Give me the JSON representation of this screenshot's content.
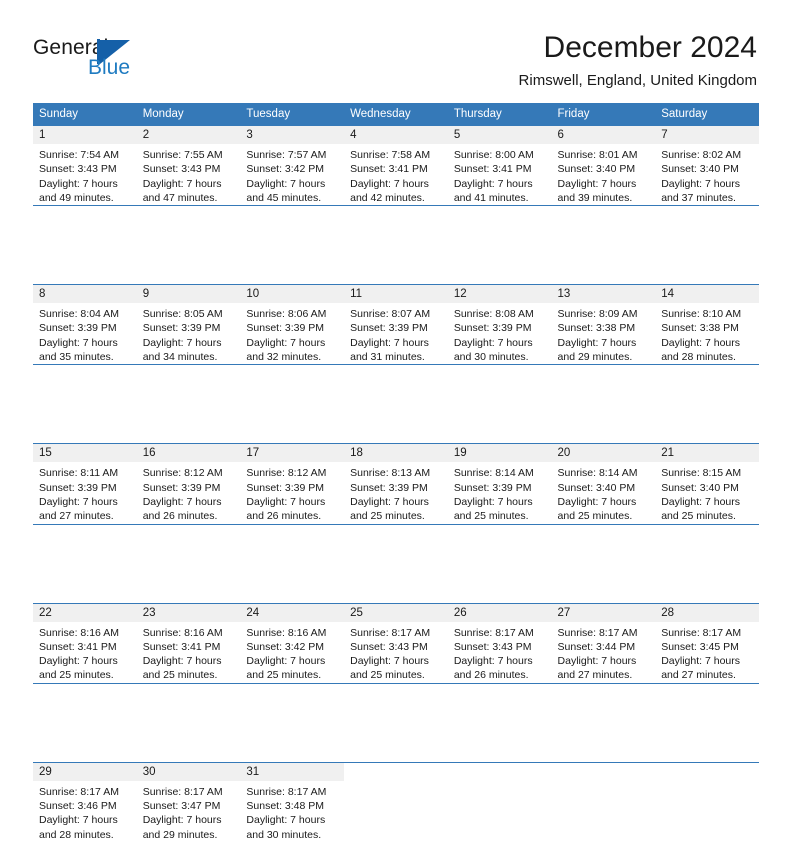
{
  "brand": {
    "name_part1": "General",
    "name_part2": "Blue",
    "logo_icon": "triangle-flag-icon",
    "accent_color": "#1560a8",
    "blue_text_color": "#1f7bc1"
  },
  "header": {
    "month_title": "December 2024",
    "location": "Rimswell, England, United Kingdom"
  },
  "calendar": {
    "header_bg": "#3579b8",
    "daynum_bg": "#f0f0f0",
    "weekday_names": [
      "Sunday",
      "Monday",
      "Tuesday",
      "Wednesday",
      "Thursday",
      "Friday",
      "Saturday"
    ],
    "weeks": [
      {
        "days": [
          {
            "num": "1",
            "sunrise": "Sunrise: 7:54 AM",
            "sunset": "Sunset: 3:43 PM",
            "daylight_1": "Daylight: 7 hours",
            "daylight_2": "and 49 minutes."
          },
          {
            "num": "2",
            "sunrise": "Sunrise: 7:55 AM",
            "sunset": "Sunset: 3:43 PM",
            "daylight_1": "Daylight: 7 hours",
            "daylight_2": "and 47 minutes."
          },
          {
            "num": "3",
            "sunrise": "Sunrise: 7:57 AM",
            "sunset": "Sunset: 3:42 PM",
            "daylight_1": "Daylight: 7 hours",
            "daylight_2": "and 45 minutes."
          },
          {
            "num": "4",
            "sunrise": "Sunrise: 7:58 AM",
            "sunset": "Sunset: 3:41 PM",
            "daylight_1": "Daylight: 7 hours",
            "daylight_2": "and 42 minutes."
          },
          {
            "num": "5",
            "sunrise": "Sunrise: 8:00 AM",
            "sunset": "Sunset: 3:41 PM",
            "daylight_1": "Daylight: 7 hours",
            "daylight_2": "and 41 minutes."
          },
          {
            "num": "6",
            "sunrise": "Sunrise: 8:01 AM",
            "sunset": "Sunset: 3:40 PM",
            "daylight_1": "Daylight: 7 hours",
            "daylight_2": "and 39 minutes."
          },
          {
            "num": "7",
            "sunrise": "Sunrise: 8:02 AM",
            "sunset": "Sunset: 3:40 PM",
            "daylight_1": "Daylight: 7 hours",
            "daylight_2": "and 37 minutes."
          }
        ]
      },
      {
        "days": [
          {
            "num": "8",
            "sunrise": "Sunrise: 8:04 AM",
            "sunset": "Sunset: 3:39 PM",
            "daylight_1": "Daylight: 7 hours",
            "daylight_2": "and 35 minutes."
          },
          {
            "num": "9",
            "sunrise": "Sunrise: 8:05 AM",
            "sunset": "Sunset: 3:39 PM",
            "daylight_1": "Daylight: 7 hours",
            "daylight_2": "and 34 minutes."
          },
          {
            "num": "10",
            "sunrise": "Sunrise: 8:06 AM",
            "sunset": "Sunset: 3:39 PM",
            "daylight_1": "Daylight: 7 hours",
            "daylight_2": "and 32 minutes."
          },
          {
            "num": "11",
            "sunrise": "Sunrise: 8:07 AM",
            "sunset": "Sunset: 3:39 PM",
            "daylight_1": "Daylight: 7 hours",
            "daylight_2": "and 31 minutes."
          },
          {
            "num": "12",
            "sunrise": "Sunrise: 8:08 AM",
            "sunset": "Sunset: 3:39 PM",
            "daylight_1": "Daylight: 7 hours",
            "daylight_2": "and 30 minutes."
          },
          {
            "num": "13",
            "sunrise": "Sunrise: 8:09 AM",
            "sunset": "Sunset: 3:38 PM",
            "daylight_1": "Daylight: 7 hours",
            "daylight_2": "and 29 minutes."
          },
          {
            "num": "14",
            "sunrise": "Sunrise: 8:10 AM",
            "sunset": "Sunset: 3:38 PM",
            "daylight_1": "Daylight: 7 hours",
            "daylight_2": "and 28 minutes."
          }
        ]
      },
      {
        "days": [
          {
            "num": "15",
            "sunrise": "Sunrise: 8:11 AM",
            "sunset": "Sunset: 3:39 PM",
            "daylight_1": "Daylight: 7 hours",
            "daylight_2": "and 27 minutes."
          },
          {
            "num": "16",
            "sunrise": "Sunrise: 8:12 AM",
            "sunset": "Sunset: 3:39 PM",
            "daylight_1": "Daylight: 7 hours",
            "daylight_2": "and 26 minutes."
          },
          {
            "num": "17",
            "sunrise": "Sunrise: 8:12 AM",
            "sunset": "Sunset: 3:39 PM",
            "daylight_1": "Daylight: 7 hours",
            "daylight_2": "and 26 minutes."
          },
          {
            "num": "18",
            "sunrise": "Sunrise: 8:13 AM",
            "sunset": "Sunset: 3:39 PM",
            "daylight_1": "Daylight: 7 hours",
            "daylight_2": "and 25 minutes."
          },
          {
            "num": "19",
            "sunrise": "Sunrise: 8:14 AM",
            "sunset": "Sunset: 3:39 PM",
            "daylight_1": "Daylight: 7 hours",
            "daylight_2": "and 25 minutes."
          },
          {
            "num": "20",
            "sunrise": "Sunrise: 8:14 AM",
            "sunset": "Sunset: 3:40 PM",
            "daylight_1": "Daylight: 7 hours",
            "daylight_2": "and 25 minutes."
          },
          {
            "num": "21",
            "sunrise": "Sunrise: 8:15 AM",
            "sunset": "Sunset: 3:40 PM",
            "daylight_1": "Daylight: 7 hours",
            "daylight_2": "and 25 minutes."
          }
        ]
      },
      {
        "days": [
          {
            "num": "22",
            "sunrise": "Sunrise: 8:16 AM",
            "sunset": "Sunset: 3:41 PM",
            "daylight_1": "Daylight: 7 hours",
            "daylight_2": "and 25 minutes."
          },
          {
            "num": "23",
            "sunrise": "Sunrise: 8:16 AM",
            "sunset": "Sunset: 3:41 PM",
            "daylight_1": "Daylight: 7 hours",
            "daylight_2": "and 25 minutes."
          },
          {
            "num": "24",
            "sunrise": "Sunrise: 8:16 AM",
            "sunset": "Sunset: 3:42 PM",
            "daylight_1": "Daylight: 7 hours",
            "daylight_2": "and 25 minutes."
          },
          {
            "num": "25",
            "sunrise": "Sunrise: 8:17 AM",
            "sunset": "Sunset: 3:43 PM",
            "daylight_1": "Daylight: 7 hours",
            "daylight_2": "and 25 minutes."
          },
          {
            "num": "26",
            "sunrise": "Sunrise: 8:17 AM",
            "sunset": "Sunset: 3:43 PM",
            "daylight_1": "Daylight: 7 hours",
            "daylight_2": "and 26 minutes."
          },
          {
            "num": "27",
            "sunrise": "Sunrise: 8:17 AM",
            "sunset": "Sunset: 3:44 PM",
            "daylight_1": "Daylight: 7 hours",
            "daylight_2": "and 27 minutes."
          },
          {
            "num": "28",
            "sunrise": "Sunrise: 8:17 AM",
            "sunset": "Sunset: 3:45 PM",
            "daylight_1": "Daylight: 7 hours",
            "daylight_2": "and 27 minutes."
          }
        ]
      },
      {
        "days": [
          {
            "num": "29",
            "sunrise": "Sunrise: 8:17 AM",
            "sunset": "Sunset: 3:46 PM",
            "daylight_1": "Daylight: 7 hours",
            "daylight_2": "and 28 minutes."
          },
          {
            "num": "30",
            "sunrise": "Sunrise: 8:17 AM",
            "sunset": "Sunset: 3:47 PM",
            "daylight_1": "Daylight: 7 hours",
            "daylight_2": "and 29 minutes."
          },
          {
            "num": "31",
            "sunrise": "Sunrise: 8:17 AM",
            "sunset": "Sunset: 3:48 PM",
            "daylight_1": "Daylight: 7 hours",
            "daylight_2": "and 30 minutes."
          },
          {
            "num": "",
            "sunrise": "",
            "sunset": "",
            "daylight_1": "",
            "daylight_2": ""
          },
          {
            "num": "",
            "sunrise": "",
            "sunset": "",
            "daylight_1": "",
            "daylight_2": ""
          },
          {
            "num": "",
            "sunrise": "",
            "sunset": "",
            "daylight_1": "",
            "daylight_2": ""
          },
          {
            "num": "",
            "sunrise": "",
            "sunset": "",
            "daylight_1": "",
            "daylight_2": ""
          }
        ]
      }
    ]
  }
}
